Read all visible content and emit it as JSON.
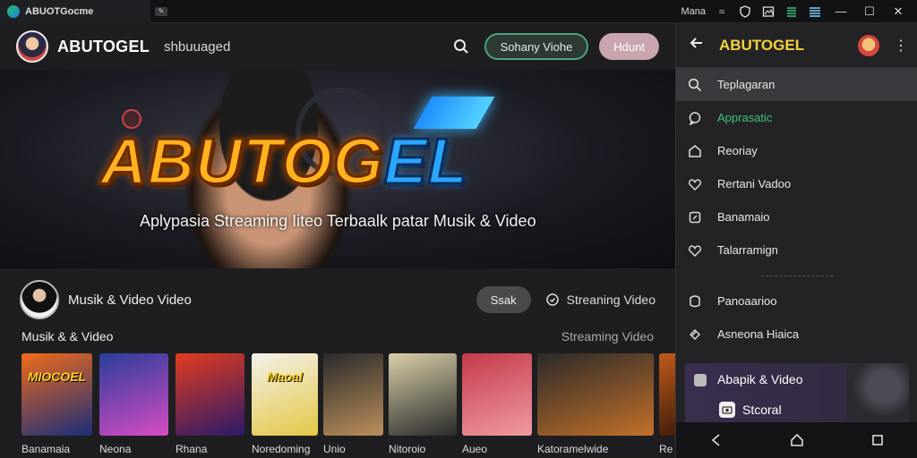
{
  "titlebar": {
    "tab_title": "ABUOTGocme",
    "tab2_glyph": "✎",
    "right_text": "Mana",
    "icons": [
      "approx-icon",
      "shield-icon",
      "image-icon",
      "list-icon",
      "list-icon-2"
    ],
    "window_controls": [
      "minimize-icon",
      "maximize-icon",
      "close-icon"
    ]
  },
  "header": {
    "brand": "ABUTOGEL",
    "subbrand": "shbuuaged",
    "primary_button": "Sohany Viohe",
    "secondary_button": "Hdunt"
  },
  "hero": {
    "title_part1": "ABUTOG",
    "title_part2": "EL",
    "subtitle": "Aplypasia Streaming Iiteo Terbaalk patar Musik & Video",
    "slides": 2,
    "active_slide": 1
  },
  "section": {
    "title": "Musik & Video Video",
    "button": "Ssak",
    "link": "Streaning Video"
  },
  "row": {
    "title": "Musik & & Video",
    "right_label": "Streaming Video"
  },
  "thumbnails": [
    {
      "label": "Banamaia",
      "caption": "MIOCOEL",
      "colors": [
        "#f06a1b",
        "#1a2e7a"
      ]
    },
    {
      "label": "Neona",
      "caption": "",
      "colors": [
        "#2a3e9a",
        "#d64cc4"
      ]
    },
    {
      "label": "Rhana",
      "caption": "",
      "colors": [
        "#e23c1e",
        "#2b1a6a"
      ]
    },
    {
      "label": "Noredoming",
      "caption": "Maoal",
      "colors": [
        "#f4f0ea",
        "#e3c845"
      ]
    },
    {
      "label": "Unio",
      "caption": "",
      "colors": [
        "#2a2a2c",
        "#bb8f5a"
      ]
    },
    {
      "label": "Nitoroio",
      "caption": "",
      "colors": [
        "#d8cfa8",
        "#2a2a2a"
      ]
    },
    {
      "label": "Aueo",
      "caption": "",
      "colors": [
        "#c43a4a",
        "#f09aa0"
      ]
    },
    {
      "label": "Katoramelwide",
      "caption": "",
      "colors": [
        "#2a2a2a",
        "#c4702a"
      ]
    },
    {
      "label": "Re",
      "caption": "",
      "colors": [
        "#c05a1a",
        "#3a1a0a"
      ]
    }
  ],
  "panel": {
    "title": "ABUTOGEL",
    "menu": [
      {
        "label": "Teplagaran",
        "icon": "search-icon",
        "active": true,
        "accent": false
      },
      {
        "label": "Apprasatic",
        "icon": "chat-icon",
        "active": false,
        "accent": true
      },
      {
        "label": "Reoriay",
        "icon": "home-icon",
        "active": false,
        "accent": false
      },
      {
        "label": "Rertani Vadoo",
        "icon": "heart-icon",
        "active": false,
        "accent": false
      },
      {
        "label": "Banamaio",
        "icon": "edit-icon",
        "active": false,
        "accent": false
      },
      {
        "label": "Talarramign",
        "icon": "heart-icon-2",
        "active": false,
        "accent": false
      }
    ],
    "menu2": [
      {
        "label": "Panoaarioo",
        "icon": "bubble-icon"
      },
      {
        "label": "Asneona Hiaica",
        "icon": "link-icon"
      }
    ],
    "card": {
      "title": "Abapik & Video",
      "chip": "Stcoral"
    },
    "navbar": [
      "back-icon",
      "home-nav-icon",
      "square-nav-icon"
    ]
  }
}
